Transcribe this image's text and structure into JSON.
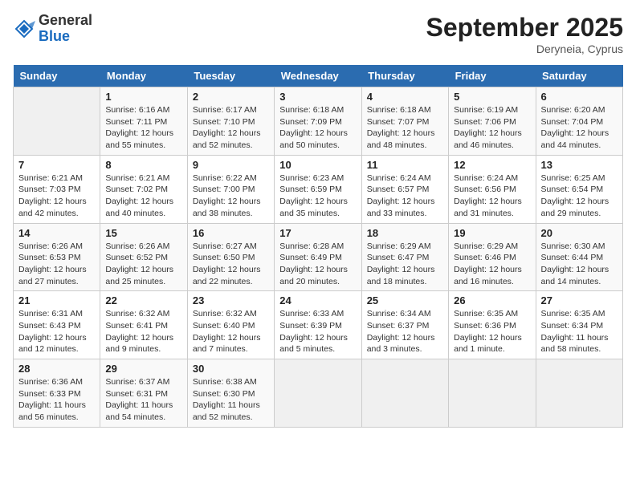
{
  "header": {
    "logo_general": "General",
    "logo_blue": "Blue",
    "month_title": "September 2025",
    "location": "Deryneia, Cyprus"
  },
  "days_of_week": [
    "Sunday",
    "Monday",
    "Tuesday",
    "Wednesday",
    "Thursday",
    "Friday",
    "Saturday"
  ],
  "weeks": [
    [
      {
        "day": "",
        "info": ""
      },
      {
        "day": "1",
        "info": "Sunrise: 6:16 AM\nSunset: 7:11 PM\nDaylight: 12 hours\nand 55 minutes."
      },
      {
        "day": "2",
        "info": "Sunrise: 6:17 AM\nSunset: 7:10 PM\nDaylight: 12 hours\nand 52 minutes."
      },
      {
        "day": "3",
        "info": "Sunrise: 6:18 AM\nSunset: 7:09 PM\nDaylight: 12 hours\nand 50 minutes."
      },
      {
        "day": "4",
        "info": "Sunrise: 6:18 AM\nSunset: 7:07 PM\nDaylight: 12 hours\nand 48 minutes."
      },
      {
        "day": "5",
        "info": "Sunrise: 6:19 AM\nSunset: 7:06 PM\nDaylight: 12 hours\nand 46 minutes."
      },
      {
        "day": "6",
        "info": "Sunrise: 6:20 AM\nSunset: 7:04 PM\nDaylight: 12 hours\nand 44 minutes."
      }
    ],
    [
      {
        "day": "7",
        "info": "Sunrise: 6:21 AM\nSunset: 7:03 PM\nDaylight: 12 hours\nand 42 minutes."
      },
      {
        "day": "8",
        "info": "Sunrise: 6:21 AM\nSunset: 7:02 PM\nDaylight: 12 hours\nand 40 minutes."
      },
      {
        "day": "9",
        "info": "Sunrise: 6:22 AM\nSunset: 7:00 PM\nDaylight: 12 hours\nand 38 minutes."
      },
      {
        "day": "10",
        "info": "Sunrise: 6:23 AM\nSunset: 6:59 PM\nDaylight: 12 hours\nand 35 minutes."
      },
      {
        "day": "11",
        "info": "Sunrise: 6:24 AM\nSunset: 6:57 PM\nDaylight: 12 hours\nand 33 minutes."
      },
      {
        "day": "12",
        "info": "Sunrise: 6:24 AM\nSunset: 6:56 PM\nDaylight: 12 hours\nand 31 minutes."
      },
      {
        "day": "13",
        "info": "Sunrise: 6:25 AM\nSunset: 6:54 PM\nDaylight: 12 hours\nand 29 minutes."
      }
    ],
    [
      {
        "day": "14",
        "info": "Sunrise: 6:26 AM\nSunset: 6:53 PM\nDaylight: 12 hours\nand 27 minutes."
      },
      {
        "day": "15",
        "info": "Sunrise: 6:26 AM\nSunset: 6:52 PM\nDaylight: 12 hours\nand 25 minutes."
      },
      {
        "day": "16",
        "info": "Sunrise: 6:27 AM\nSunset: 6:50 PM\nDaylight: 12 hours\nand 22 minutes."
      },
      {
        "day": "17",
        "info": "Sunrise: 6:28 AM\nSunset: 6:49 PM\nDaylight: 12 hours\nand 20 minutes."
      },
      {
        "day": "18",
        "info": "Sunrise: 6:29 AM\nSunset: 6:47 PM\nDaylight: 12 hours\nand 18 minutes."
      },
      {
        "day": "19",
        "info": "Sunrise: 6:29 AM\nSunset: 6:46 PM\nDaylight: 12 hours\nand 16 minutes."
      },
      {
        "day": "20",
        "info": "Sunrise: 6:30 AM\nSunset: 6:44 PM\nDaylight: 12 hours\nand 14 minutes."
      }
    ],
    [
      {
        "day": "21",
        "info": "Sunrise: 6:31 AM\nSunset: 6:43 PM\nDaylight: 12 hours\nand 12 minutes."
      },
      {
        "day": "22",
        "info": "Sunrise: 6:32 AM\nSunset: 6:41 PM\nDaylight: 12 hours\nand 9 minutes."
      },
      {
        "day": "23",
        "info": "Sunrise: 6:32 AM\nSunset: 6:40 PM\nDaylight: 12 hours\nand 7 minutes."
      },
      {
        "day": "24",
        "info": "Sunrise: 6:33 AM\nSunset: 6:39 PM\nDaylight: 12 hours\nand 5 minutes."
      },
      {
        "day": "25",
        "info": "Sunrise: 6:34 AM\nSunset: 6:37 PM\nDaylight: 12 hours\nand 3 minutes."
      },
      {
        "day": "26",
        "info": "Sunrise: 6:35 AM\nSunset: 6:36 PM\nDaylight: 12 hours\nand 1 minute."
      },
      {
        "day": "27",
        "info": "Sunrise: 6:35 AM\nSunset: 6:34 PM\nDaylight: 11 hours\nand 58 minutes."
      }
    ],
    [
      {
        "day": "28",
        "info": "Sunrise: 6:36 AM\nSunset: 6:33 PM\nDaylight: 11 hours\nand 56 minutes."
      },
      {
        "day": "29",
        "info": "Sunrise: 6:37 AM\nSunset: 6:31 PM\nDaylight: 11 hours\nand 54 minutes."
      },
      {
        "day": "30",
        "info": "Sunrise: 6:38 AM\nSunset: 6:30 PM\nDaylight: 11 hours\nand 52 minutes."
      },
      {
        "day": "",
        "info": ""
      },
      {
        "day": "",
        "info": ""
      },
      {
        "day": "",
        "info": ""
      },
      {
        "day": "",
        "info": ""
      }
    ]
  ]
}
